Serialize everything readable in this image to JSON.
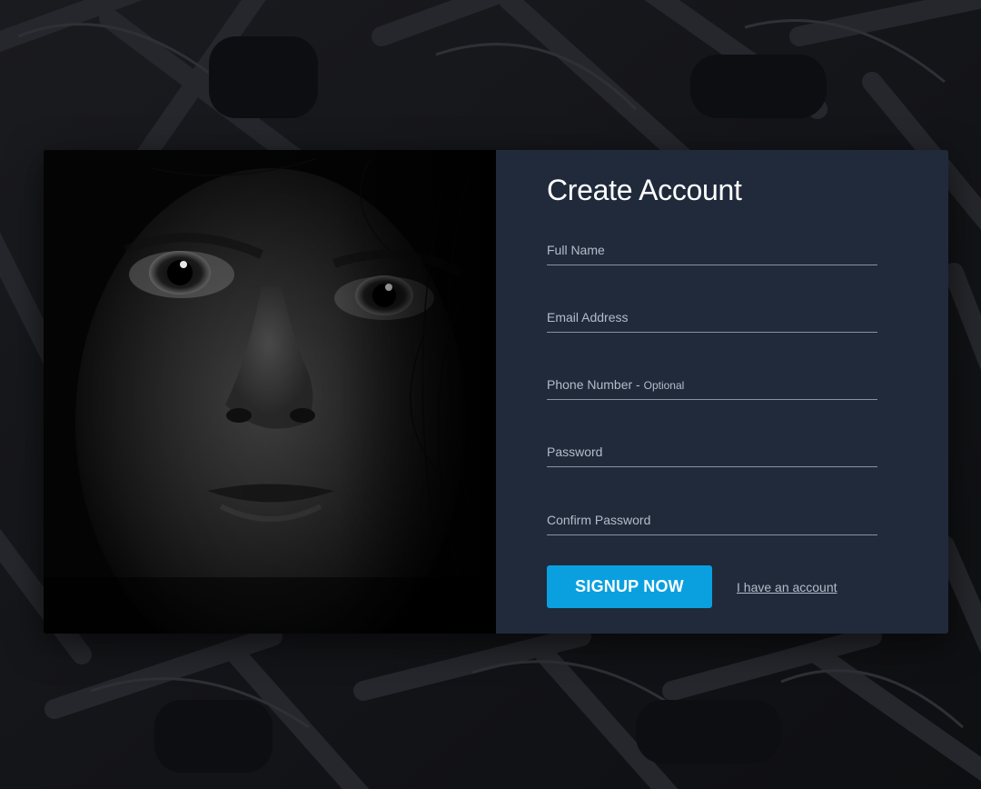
{
  "form": {
    "title": "Create Account",
    "fields": [
      {
        "label": "Full Name",
        "note": ""
      },
      {
        "label": "Email Address",
        "note": ""
      },
      {
        "label": "Phone Number - ",
        "note": "Optional"
      },
      {
        "label": "Password",
        "note": ""
      },
      {
        "label": "Confirm Password",
        "note": ""
      }
    ],
    "signup_label": "SIGNUP NOW",
    "login_link_label": "I have an account"
  },
  "colors": {
    "background": "#121316",
    "form_panel": "#202a3b",
    "accent": "#0aa0e0",
    "field_text": "#b5bcc8"
  },
  "image": {
    "description_icon": "portrait-photo"
  }
}
